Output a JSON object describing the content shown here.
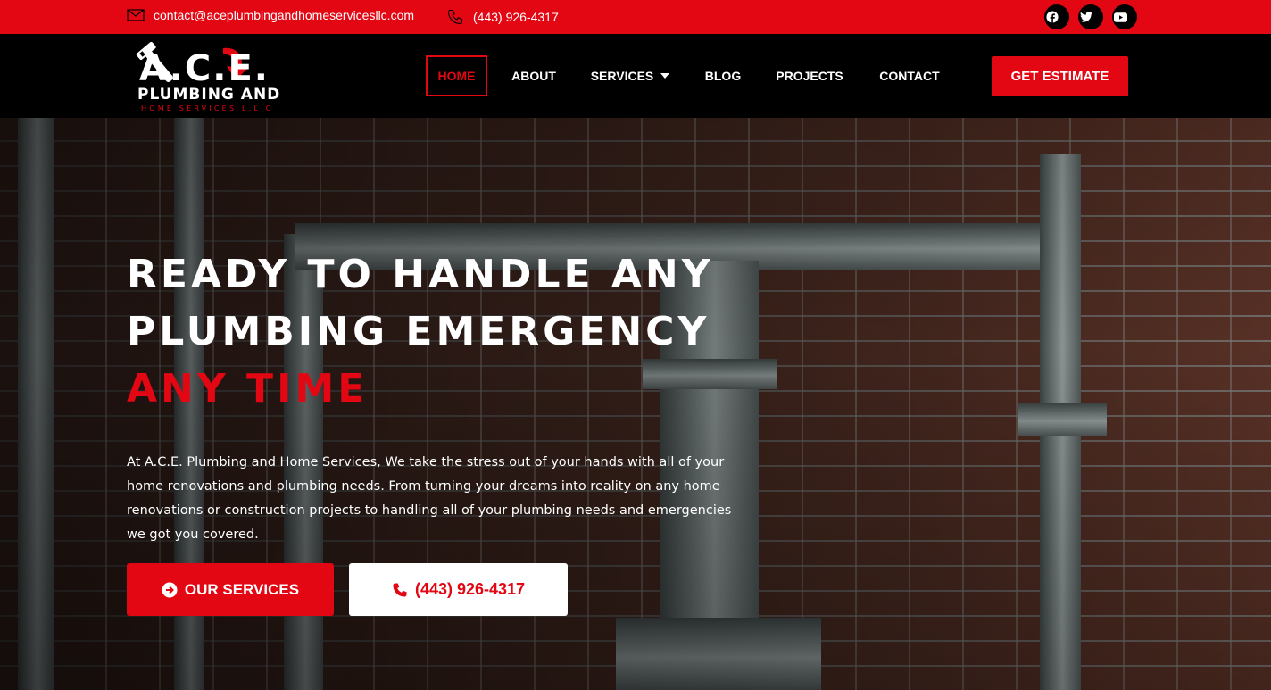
{
  "topbar": {
    "email": "contact@aceplumbingandhomeservicesllc.com",
    "phone": "(443) 926-4317",
    "social_icons": [
      "facebook-icon",
      "twitter-icon",
      "youtube-icon"
    ]
  },
  "header": {
    "logo_text_main": "A.C.E.",
    "logo_text_sub": "PLUMBING AND",
    "logo_text_tag": "HOME SERVICES L.L.C",
    "nav": {
      "home": "HOME",
      "about": "ABOUT",
      "services": "SERVICES",
      "blog": "BLOG",
      "projects": "PROJECTS",
      "contact": "CONTACT"
    },
    "cta": "GET ESTIMATE"
  },
  "hero": {
    "line1": "Ready to handle any",
    "line2": "plumbing emergency",
    "line3": "any time",
    "paragraph": "At A.C.E. Plumbing and Home Services, We take the stress out of your hands with all of your home renovations and plumbing needs. From turning your dreams into reality on any home renovations or construction projects to handling all of your plumbing needs and emergencies we got you covered.",
    "btn_services": "OUR SERVICES",
    "btn_phone": "(443) 926-4317"
  },
  "colors": {
    "accent": "#e30613",
    "header_bg": "#000000",
    "white": "#ffffff"
  }
}
